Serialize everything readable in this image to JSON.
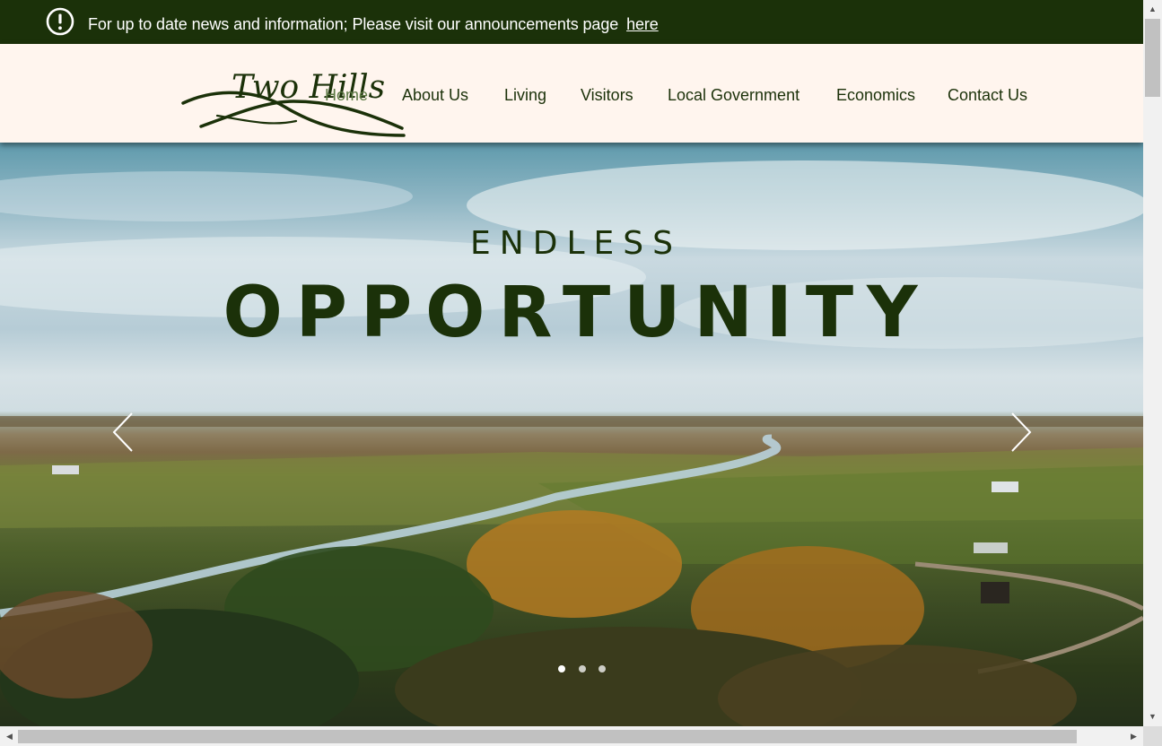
{
  "announcement": {
    "text": "For up to date news and information;  Please visit our announcements page",
    "link_text": "here",
    "icon": "exclamation-circle-icon"
  },
  "logo": {
    "text": "Two Hills"
  },
  "nav": {
    "items": [
      {
        "label": "Home",
        "active": true
      },
      {
        "label": "About Us"
      },
      {
        "label": "Living"
      },
      {
        "label": "Visitors"
      },
      {
        "label": "Local Government"
      },
      {
        "label": "Economics"
      },
      {
        "label": "Contact Us"
      }
    ]
  },
  "hero": {
    "headline_small": "ENDLESS",
    "headline_big": "OPPORTUNITY",
    "prev_icon": "chevron-left-icon",
    "next_icon": "chevron-right-icon",
    "slides": {
      "count": 3,
      "active": 0
    }
  },
  "colors": {
    "brand_dark_green": "#1b3109",
    "active_nav_green": "#5e7a45",
    "header_background": "#fff5ee"
  }
}
